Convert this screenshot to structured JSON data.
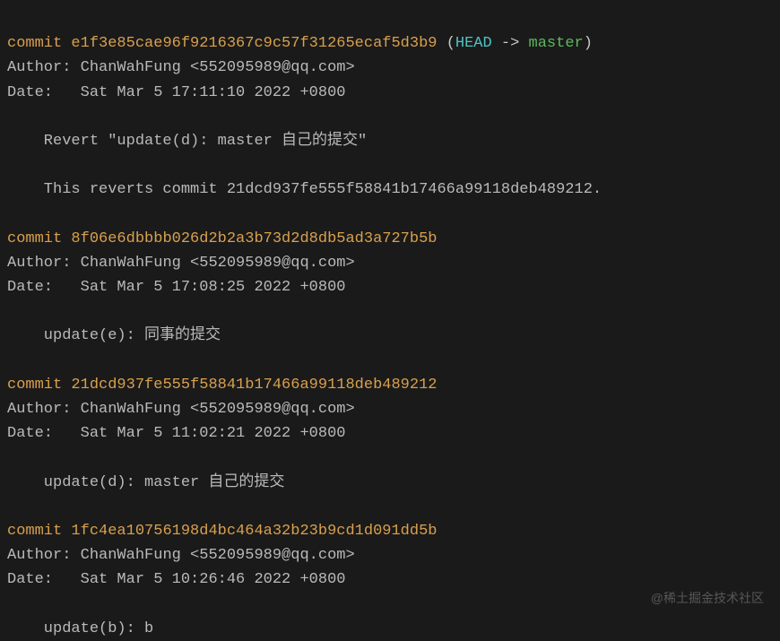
{
  "watermark": "@稀土掘金技术社区",
  "log": {
    "commit_prefix": "commit ",
    "author_prefix": "Author: ",
    "date_prefix": "Date:   ",
    "head_ref": {
      "open": "(",
      "head": "HEAD",
      "arrow": " -> ",
      "branch": "master",
      "close": ")"
    },
    "commits": [
      {
        "hash": "e1f3e85cae96f9216367c9c57f31265ecaf5d3b9",
        "is_head": true,
        "author": "ChanWahFung <552095989@qq.com>",
        "date": "Sat Mar 5 17:11:10 2022 +0800",
        "body": [
          "    Revert \"update(d): master 自己的提交\"",
          "",
          "    This reverts commit 21dcd937fe555f58841b17466a99118deb489212."
        ]
      },
      {
        "hash": "8f06e6dbbbb026d2b2a3b73d2d8db5ad3a727b5b",
        "is_head": false,
        "author": "ChanWahFung <552095989@qq.com>",
        "date": "Sat Mar 5 17:08:25 2022 +0800",
        "body": [
          "    update(e): 同事的提交"
        ]
      },
      {
        "hash": "21dcd937fe555f58841b17466a99118deb489212",
        "is_head": false,
        "author": "ChanWahFung <552095989@qq.com>",
        "date": "Sat Mar 5 11:02:21 2022 +0800",
        "body": [
          "    update(d): master 自己的提交"
        ]
      },
      {
        "hash": "1fc4ea10756198d4bc464a32b23b9cd1d091dd5b",
        "is_head": false,
        "author": "ChanWahFung <552095989@qq.com>",
        "date": "Sat Mar 5 10:26:46 2022 +0800",
        "body": [
          "    update(b): b"
        ]
      }
    ]
  }
}
